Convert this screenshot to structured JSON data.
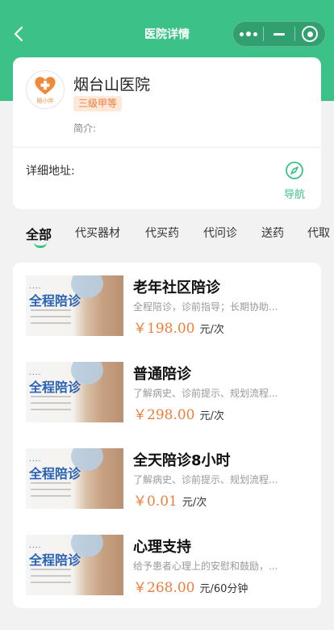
{
  "nav": {
    "title": "医院详情"
  },
  "hospital": {
    "logo_text": "陪小伴",
    "name": "烟台山医院",
    "level": "三级甲等",
    "intro_label": "简介:",
    "address_label": "详细地址:",
    "navigate_label": "导航"
  },
  "tabs": [
    "全部",
    "代买器材",
    "代买药",
    "代问诊",
    "送药",
    "代取"
  ],
  "active_tab": "全部",
  "thumbnail": {
    "dots": "....",
    "title": "全程陪诊"
  },
  "services": [
    {
      "title": "老年社区陪诊",
      "desc": "全程陪诊，诊前指导；长期协助...",
      "price": "￥198.00",
      "unit": "元/次"
    },
    {
      "title": "普通陪诊",
      "desc": "了解病史、诊前提示、规划流程...",
      "price": "￥298.00",
      "unit": "元/次"
    },
    {
      "title": "全天陪诊8小时",
      "desc": "了解病史、诊前提示、规划流程...",
      "price": "￥0.01",
      "unit": "元/次"
    },
    {
      "title": "心理支持",
      "desc": "给予患者心理上的安慰和鼓励，...",
      "price": "￥268.00",
      "unit": "元/60分钟"
    }
  ],
  "colors": {
    "brand_green": "#3cc288",
    "price_orange": "#ef7e3a",
    "badge_bg": "#fde8da"
  },
  "icons": {
    "back": "chevron-left-icon",
    "more": "more-dots-icon",
    "minimize": "minus-icon",
    "close": "target-circle-icon",
    "navigate": "compass-icon",
    "logo": "heart-cross-icon"
  }
}
